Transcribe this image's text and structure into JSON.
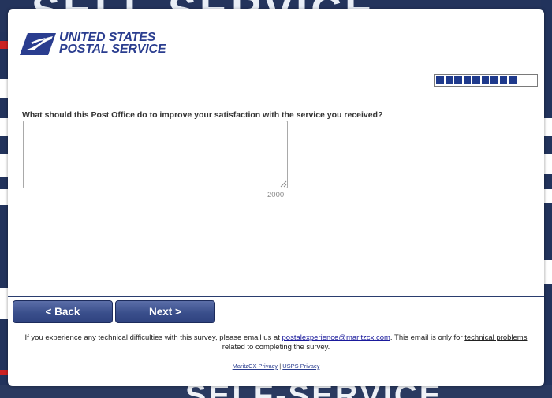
{
  "background": {
    "top_word": "SELF SERVICE",
    "bottom_word": "SELF-SERVICE"
  },
  "logo": {
    "line1": "UNITED STATES",
    "line2": "POSTAL SERVICE",
    "registered": "®",
    "icon": "usps-eagle-icon"
  },
  "progress": {
    "filled_segments": 9,
    "total_segments": 12,
    "fraction": 0.75
  },
  "question": {
    "text": "What should this Post Office do to improve your satisfaction with the service you received?",
    "answer_value": "",
    "char_limit": "2000"
  },
  "nav": {
    "back_label": "< Back",
    "next_label": "Next >"
  },
  "footer": {
    "text_before": "If you experience any technical difficulties with this survey, please email us at ",
    "email": "postalexperience@maritzcx.com",
    "text_middle": ". This email is only for ",
    "technical_problems": "technical problems",
    "text_after": " related to completing the survey."
  },
  "privacy": {
    "maritz": "MaritzCX Privacy",
    "separator": " | ",
    "usps": "USPS Privacy"
  },
  "colors": {
    "brand_blue": "#2a3d8f",
    "progress_fill": "#1f3a8c",
    "button_top": "#5b6ea8",
    "button_bottom": "#2f437f"
  }
}
